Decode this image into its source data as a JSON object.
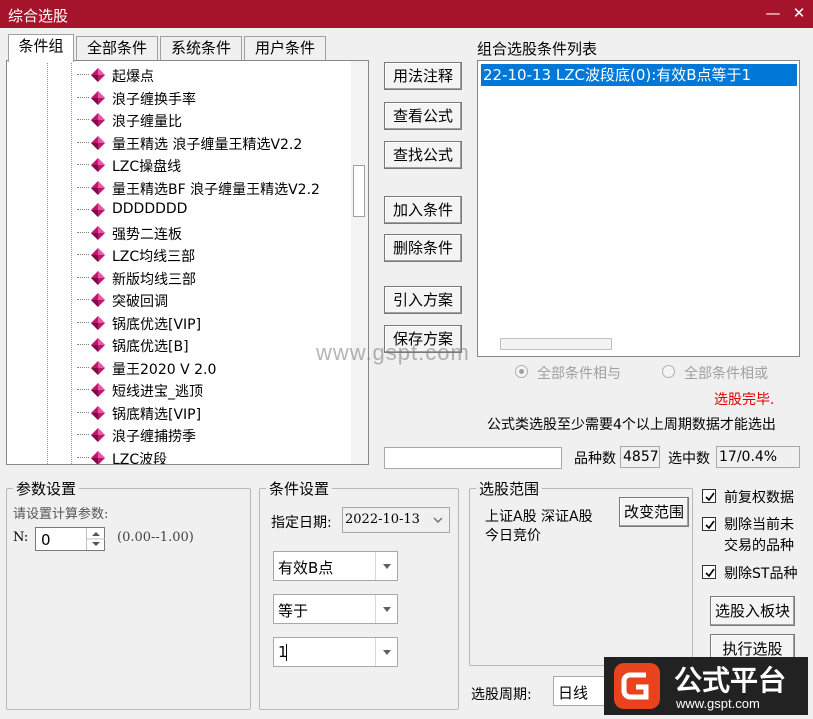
{
  "window": {
    "title": "综合选股",
    "minimize": "—",
    "close": "✕"
  },
  "tabs": [
    "条件组",
    "全部条件",
    "系统条件",
    "用户条件"
  ],
  "tree_items": [
    "起爆点",
    "浪子缠换手率",
    "浪子缠量比",
    "量王精选 浪子缠量王精选V2.2",
    "LZC操盘线",
    "量王精选BF 浪子缠量王精选V2.2",
    "DDDDDDD",
    "强势二连板",
    "LZC均线三部",
    "新版均线三部",
    "突破回调",
    "锅底优选[VIP]",
    "锅底优选[B]",
    "量王2020 V 2.0",
    "短线进宝_逃顶",
    "锅底精选[VIP]",
    "浪子缠捕捞季",
    "LZC波段"
  ],
  "buttons": {
    "usage": "用法注释",
    "view_formula": "查看公式",
    "find_formula": "查找公式",
    "add_condition": "加入条件",
    "delete_condition": "删除条件",
    "import_plan": "引入方案",
    "save_plan": "保存方案",
    "change_range": "改变范围",
    "to_block": "选股入板块",
    "execute": "执行选股"
  },
  "condition_list": {
    "label": "组合选股条件列表",
    "items": [
      "22-10-13 LZC波段底(0):有效B点等于1"
    ]
  },
  "logic": {
    "and_label": "全部条件相与",
    "or_label": "全部条件相或",
    "selected": "and"
  },
  "status": {
    "done": "选股完毕.",
    "note": "公式类选股至少需要4个以上周期数据才能选出"
  },
  "counts": {
    "total_label": "品种数",
    "total": "4857",
    "selected_label": "选中数",
    "selected": "17/0.4%"
  },
  "params": {
    "title": "参数设置",
    "prompt": "请设置计算参数:",
    "n_label": "N:",
    "n_value": "0",
    "range": "(0.00--1.00)"
  },
  "cond_settings": {
    "title": "条件设置",
    "date_label": "指定日期:",
    "date": "2022-10-13",
    "line": "有效B点",
    "op": "等于",
    "value": "1"
  },
  "range": {
    "title": "选股范围",
    "text1": "上证A股 深证A股",
    "text2": "今日竞价"
  },
  "options": [
    {
      "label": "前复权数据",
      "checked": true
    },
    {
      "label": "剔除当前未交易的品种",
      "checked": true
    },
    {
      "label": "剔除ST品种",
      "checked": true
    }
  ],
  "period": {
    "label": "选股周期:",
    "value": "日线"
  },
  "watermark": {
    "text": "www.gspt.com",
    "logo_text": "公式平台",
    "logo_url": "www.gspt.com"
  },
  "colors": {
    "titlebar": "#a5142a",
    "selection": "#0078d7",
    "status_red": "#e00000",
    "gem": "#c0166e"
  }
}
